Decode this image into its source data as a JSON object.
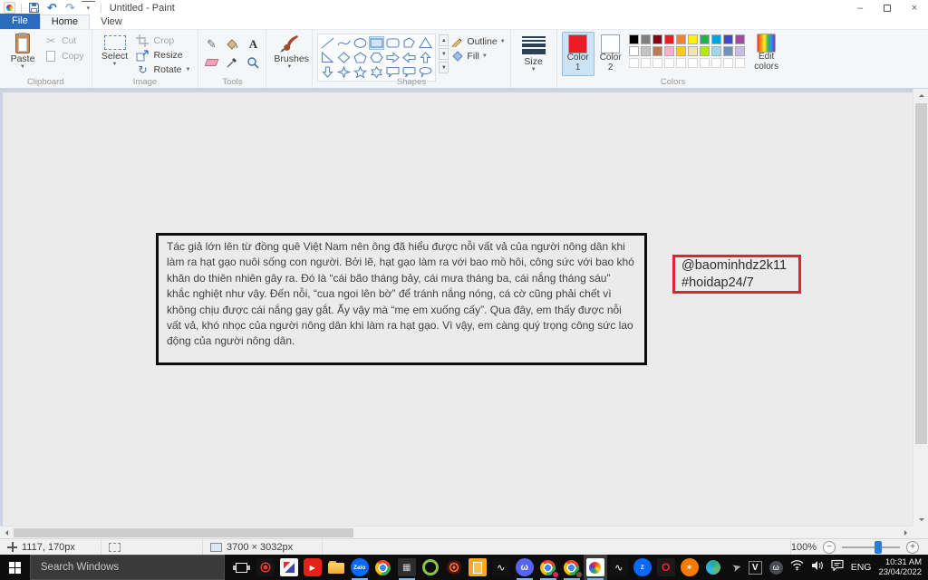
{
  "window": {
    "title": "Untitled - Paint"
  },
  "ribbon": {
    "tabs": [
      "File",
      "Home",
      "View"
    ],
    "clipboard": {
      "label": "Clipboard",
      "paste": "Paste",
      "cut": "Cut",
      "copy": "Copy"
    },
    "image": {
      "label": "Image",
      "select": "Select",
      "crop": "Crop",
      "resize": "Resize",
      "rotate": "Rotate"
    },
    "tools": {
      "label": "Tools"
    },
    "brushes": {
      "label": "Brushes"
    },
    "shapes": {
      "label": "Shapes",
      "outline": "Outline",
      "fill": "Fill",
      "selected": "rectangle",
      "items": [
        "line",
        "curve",
        "oval",
        "rectangle",
        "rounded-rectangle",
        "polygon",
        "triangle",
        "right-triangle",
        "diamond",
        "pentagon",
        "hexagon",
        "right-arrow",
        "left-arrow",
        "up-arrow",
        "down-arrow",
        "four-point-star",
        "five-point-star",
        "six-point-star",
        "rectangular-callout",
        "rounded-callout",
        "oval-callout"
      ]
    },
    "size": {
      "label": "Size"
    },
    "colors": {
      "label": "Colors",
      "color1_label": "Color 1",
      "color2_label": "Color 2",
      "edit_label": "Edit colors",
      "color1": "#ed1c24",
      "color2": "#ffffff",
      "palette": [
        [
          "#000000",
          "#7f7f7f",
          "#880015",
          "#ed1c24",
          "#ff7f27",
          "#fff200",
          "#22b14c",
          "#00a2e8",
          "#3f48cc",
          "#a349a4"
        ],
        [
          "#ffffff",
          "#c3c3c3",
          "#b97a57",
          "#ffaec9",
          "#ffc90e",
          "#efe4b0",
          "#b5e61d",
          "#99d9ea",
          "#7092be",
          "#c8bfe7"
        ]
      ],
      "custom_slots": 10
    }
  },
  "canvas": {
    "essay_text": "Tác giả lớn lên từ đồng quê Việt Nam nên ông đã hiểu được nỗi vất vả của người nông dân khi làm ra hạt gạo nuôi sống con người. Bởi lẽ, hạt gạo làm ra với bao mồ hôi, công sức với bao khó khăn do thiên nhiên gây ra. Đó là “cái bão tháng bảy, cái mưa tháng ba, cái nắng tháng sáu” khắc nghiệt như vậy. Đến nỗi, “cua ngoi lên bờ” để tránh nắng nóng, cá cờ cũng phải chết vì không chịu được cái nắng gay gắt. Ấy vậy mà “mẹ em xuống cấy”. Qua đây, em thấy được nỗi vất vả, khó nhọc của người nông dân khi làm ra hạt gạo. Vì vậy, em càng quý trọng công sức lao động của người nông dân.",
    "watermark_line1": "@baominhdz2k11",
    "watermark_line2": "#hoidap24/7"
  },
  "statusbar": {
    "cursor_pos": "1117, 170px",
    "image_size": "3700 × 3032px",
    "zoom_level": "100%"
  },
  "taskbar": {
    "search_placeholder": "Search Windows",
    "apps": [
      {
        "name": "task-view-button",
        "kind": "taskview",
        "glyph": "",
        "underline": false
      },
      {
        "name": "screen-recorder-icon",
        "kind": "recorder",
        "glyph": "",
        "underline": false
      },
      {
        "name": "video-editor-icon",
        "kind": "editor",
        "glyph": "",
        "underline": false
      },
      {
        "name": "youtube-icon",
        "kind": "youtube",
        "glyph": "▶",
        "underline": false
      },
      {
        "name": "file-explorer-icon",
        "kind": "explorer",
        "glyph": "",
        "underline": false
      },
      {
        "name": "zalo-icon",
        "kind": "zalo",
        "glyph": "Zalo",
        "underline": true
      },
      {
        "name": "chrome-icon",
        "kind": "chrome",
        "glyph": "",
        "underline": false
      },
      {
        "name": "calculator-icon",
        "kind": "calc",
        "glyph": "▦",
        "underline": true
      },
      {
        "name": "green-ring-app-icon",
        "kind": "green",
        "glyph": "",
        "underline": false
      },
      {
        "name": "spiral-app-icon",
        "kind": "spiral",
        "glyph": "",
        "underline": false
      },
      {
        "name": "orange-app-icon",
        "kind": "orangebox",
        "glyph": "",
        "underline": false
      },
      {
        "name": "bird-app-icon",
        "kind": "bird",
        "glyph": "∿",
        "underline": false
      },
      {
        "name": "discord-icon",
        "kind": "discord",
        "glyph": "ω",
        "underline": true
      },
      {
        "name": "chrome-profile-1-icon",
        "kind": "chrome",
        "glyph": "",
        "avatar": "#e91e63",
        "underline": true
      },
      {
        "name": "chrome-profile-2-icon",
        "kind": "chrome",
        "glyph": "",
        "avatar": "#795548",
        "underline": true
      },
      {
        "name": "paint-taskbar-icon",
        "kind": "paint",
        "glyph": "",
        "underline": true,
        "active": true
      },
      {
        "name": "bird-app-2-icon",
        "kind": "bird",
        "glyph": "∿",
        "underline": false
      },
      {
        "name": "blue-messenger-icon",
        "kind": "zalo",
        "glyph": "Z",
        "underline": false
      },
      {
        "name": "opera-icon",
        "kind": "opera",
        "glyph": "O",
        "underline": false
      },
      {
        "name": "orange-game-icon",
        "kind": "orangeapp",
        "glyph": "✶",
        "underline": false
      },
      {
        "name": "swirl-app-icon",
        "kind": "swirl",
        "glyph": "",
        "underline": false
      },
      {
        "name": "send-app-icon",
        "kind": "plane",
        "glyph": "➤",
        "underline": false
      }
    ],
    "tray": {
      "language": "ENG",
      "time": "10:31 AM",
      "date": "23/04/2022"
    }
  }
}
